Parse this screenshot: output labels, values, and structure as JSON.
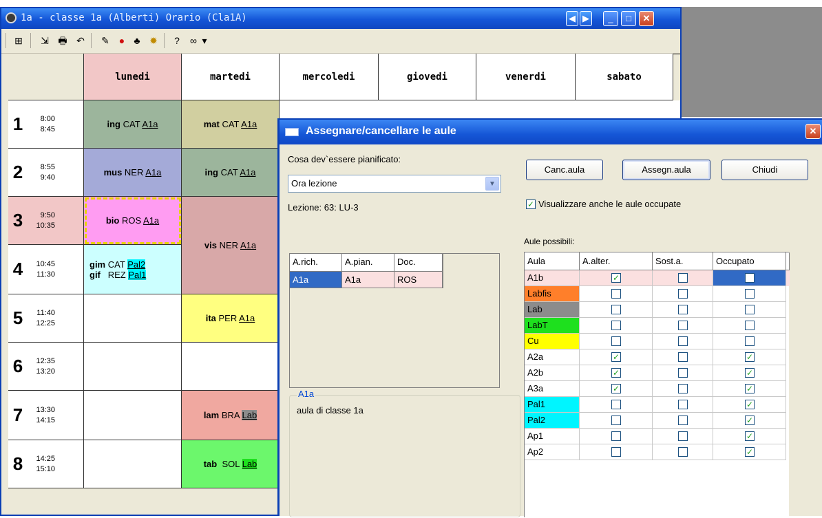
{
  "main_window": {
    "title": "1a - classe 1a (Alberti)  Orario  (Cla1A)",
    "buttons": {
      "prev": "◀",
      "next": "▶",
      "minimize": "_",
      "maximize": "□",
      "close": "✕"
    },
    "toolbar_icons": [
      "grid-plus-icon",
      "export-icon",
      "print-icon",
      "undo-icon",
      "paint-icon",
      "pin-icon",
      "people-icon",
      "gear-icon",
      "help-icon",
      "binoculars-icon",
      "dropdown-icon"
    ],
    "days": [
      "lunedi",
      "martedi",
      "mercoledi",
      "giovedi",
      "venerdi",
      "sabato"
    ],
    "periods": [
      {
        "n": "1",
        "start": "8:00",
        "end": "8:45"
      },
      {
        "n": "2",
        "start": "8:55",
        "end": "9:40"
      },
      {
        "n": "3",
        "start": "9:50",
        "end": "10:35"
      },
      {
        "n": "4",
        "start": "10:45",
        "end": "11:30"
      },
      {
        "n": "5",
        "start": "11:40",
        "end": "12:25"
      },
      {
        "n": "6",
        "start": "12:35",
        "end": "13:20"
      },
      {
        "n": "7",
        "start": "13:30",
        "end": "14:15"
      },
      {
        "n": "8",
        "start": "14:25",
        "end": "15:10"
      }
    ],
    "lessons": {
      "mon_1": {
        "subject": "ing",
        "teacher": "CAT",
        "room": "A1a"
      },
      "mon_2": {
        "subject": "mus",
        "teacher": "NER",
        "room": "A1a"
      },
      "mon_3": {
        "subject": "bio",
        "teacher": "ROS",
        "room": "A1a"
      },
      "mon_4a": {
        "subject": "gim",
        "teacher": "CAT",
        "room": "Pal2"
      },
      "mon_4b": {
        "subject": "gif",
        "teacher": "REZ",
        "room": "Pal1"
      },
      "tue_1": {
        "subject": "mat",
        "teacher": "CAT",
        "room": "A1a"
      },
      "tue_2": {
        "subject": "ing",
        "teacher": "CAT",
        "room": "A1a"
      },
      "tue_34": {
        "subject": "vis",
        "teacher": "NER",
        "room": "A1a"
      },
      "tue_5": {
        "subject": "ita",
        "teacher": "PER",
        "room": "A1a"
      },
      "tue_7": {
        "subject": "lam",
        "teacher": "BRA",
        "room": "Lab"
      },
      "tue_8": {
        "subject": "tab",
        "teacher": "SOL",
        "room": "Lab"
      }
    }
  },
  "dialog": {
    "title": "Assegnare/cancellare le aule",
    "close": "✕",
    "planned_label": "Cosa dev`essere pianificato:",
    "planned_value": "Ora lezione",
    "lesson_label": "Lezione: 63: LU-3",
    "btn_canc": "Canc.aula",
    "btn_assegn": "Assegn.aula",
    "btn_chiudi": "Chiudi",
    "show_occupied_label": "Visualizzare anche le aule occupate",
    "show_occupied_checked": "✓",
    "aule_label": "Aule possibili:",
    "left_table": {
      "headers": [
        "A.rich.",
        "A.pian.",
        "Doc."
      ],
      "row": [
        "A1a",
        "A1a",
        "ROS"
      ]
    },
    "group": {
      "legend": "A1a",
      "text": "aula di classe 1a"
    },
    "rooms": {
      "headers": [
        "Aula",
        "A.alter.",
        "Sost.a.",
        "Occupato"
      ],
      "rows": [
        {
          "aula": "A1b",
          "alt": "✓",
          "sost": "",
          "occ": ""
        },
        {
          "aula": "Labfis",
          "alt": "",
          "sost": "",
          "occ": ""
        },
        {
          "aula": "Lab",
          "alt": "",
          "sost": "",
          "occ": ""
        },
        {
          "aula": "LabT",
          "alt": "",
          "sost": "",
          "occ": ""
        },
        {
          "aula": "Cu",
          "alt": "",
          "sost": "",
          "occ": ""
        },
        {
          "aula": "A2a",
          "alt": "✓",
          "sost": "",
          "occ": "✓"
        },
        {
          "aula": "A2b",
          "alt": "✓",
          "sost": "",
          "occ": "✓"
        },
        {
          "aula": "A3a",
          "alt": "✓",
          "sost": "",
          "occ": "✓"
        },
        {
          "aula": "Pal1",
          "alt": "",
          "sost": "",
          "occ": "✓"
        },
        {
          "aula": "Pal2",
          "alt": "",
          "sost": "",
          "occ": "✓"
        },
        {
          "aula": "Ap1",
          "alt": "",
          "sost": "",
          "occ": "✓"
        },
        {
          "aula": "Ap2",
          "alt": "",
          "sost": "",
          "occ": "✓"
        }
      ]
    }
  },
  "colors": {
    "green_cell": "#9cb59c",
    "blue_cell": "#a4aad8",
    "pink_cell": "#f2c7c7",
    "magenta_cell": "#ff9cf2",
    "cyan_cell": "#ccffff",
    "khaki_cell": "#d1cfa0",
    "rose_cell": "#d8a8a8",
    "yellow_cell": "#ffff80",
    "salmon_cell": "#f0a8a0",
    "lime_cell": "#6cf76c",
    "labfis": "#ff7f2a",
    "lab": "#8c8c8c",
    "labT": "#1ee01e",
    "cu": "#ffff00",
    "pal": "#00f5ff",
    "selected": "#316ac5"
  }
}
